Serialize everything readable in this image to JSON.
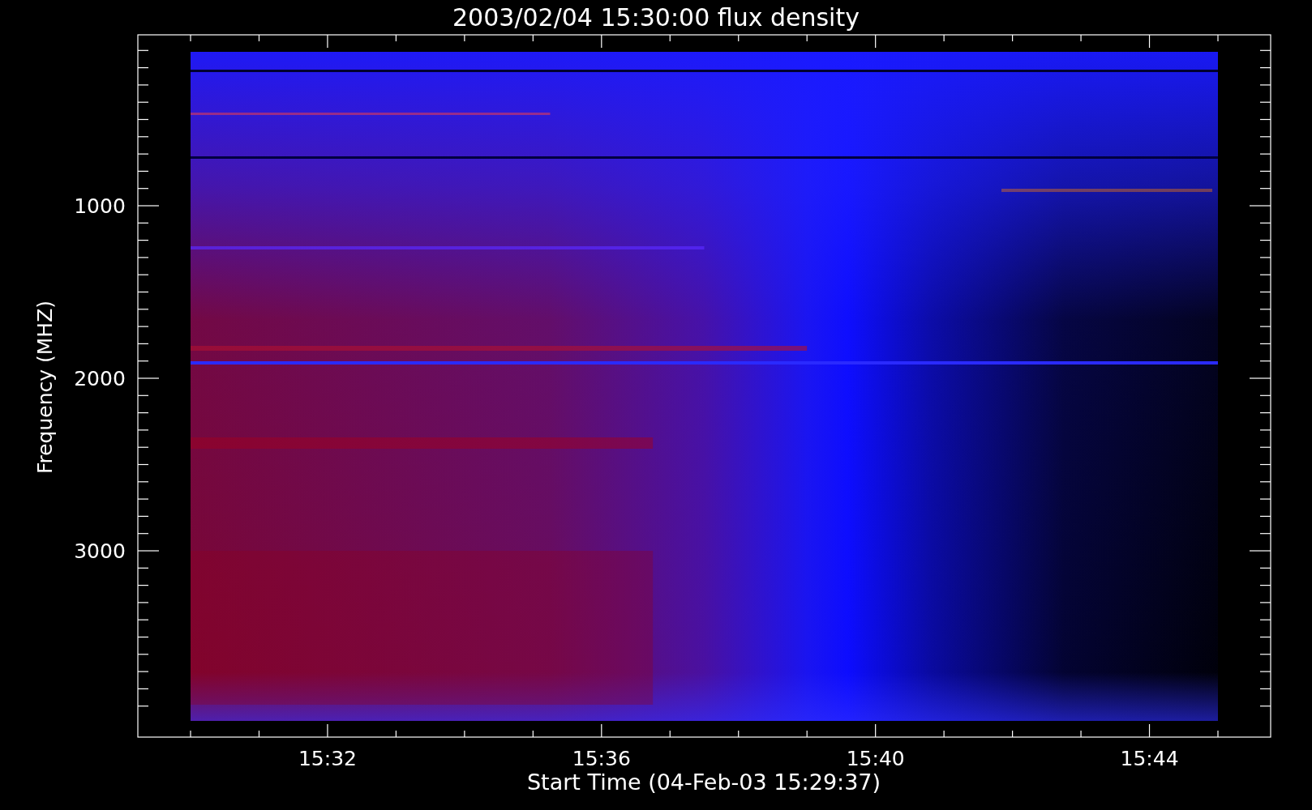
{
  "plot": {
    "title": "2003/02/04 15:30:00 flux density",
    "xlabel": "Start Time (04-Feb-03 15:29:37)",
    "ylabel": "Frequency (MHZ)",
    "x_tick_labels": [
      "15:32",
      "15:36",
      "15:40",
      "15:44"
    ],
    "y_tick_labels": [
      "1000",
      "2000",
      "3000"
    ]
  }
}
